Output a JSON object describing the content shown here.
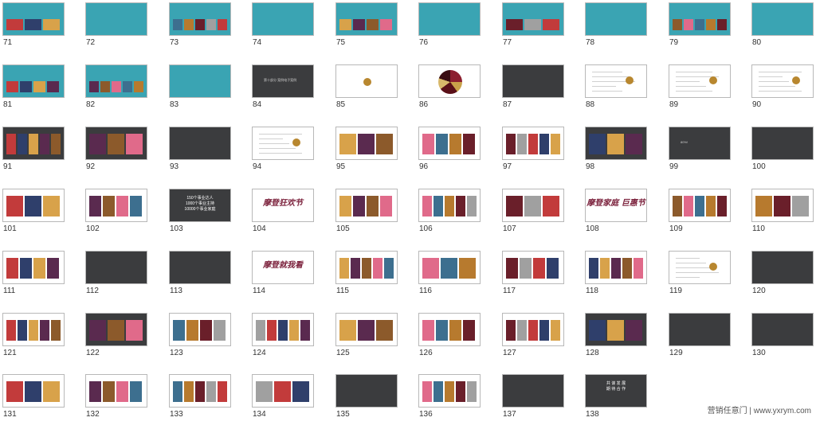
{
  "slides": [
    {
      "n": "71",
      "bg": "teal",
      "kind": "photos"
    },
    {
      "n": "72",
      "bg": "teal",
      "kind": "text"
    },
    {
      "n": "73",
      "bg": "teal",
      "kind": "photos"
    },
    {
      "n": "74",
      "bg": "teal",
      "kind": "text"
    },
    {
      "n": "75",
      "bg": "teal",
      "kind": "photos"
    },
    {
      "n": "76",
      "bg": "teal",
      "kind": "text"
    },
    {
      "n": "77",
      "bg": "teal",
      "kind": "photos"
    },
    {
      "n": "78",
      "bg": "teal",
      "kind": "text"
    },
    {
      "n": "79",
      "bg": "teal",
      "kind": "photos"
    },
    {
      "n": "80",
      "bg": "teal",
      "kind": "text"
    },
    {
      "n": "81",
      "bg": "teal",
      "kind": "photos"
    },
    {
      "n": "82",
      "bg": "teal",
      "kind": "photos"
    },
    {
      "n": "83",
      "bg": "teal",
      "kind": "text"
    },
    {
      "n": "84",
      "bg": "dark",
      "kind": "text",
      "text": "第十部分 案例电子案例"
    },
    {
      "n": "85",
      "bg": "white",
      "kind": "logo"
    },
    {
      "n": "86",
      "bg": "white",
      "kind": "logo-big"
    },
    {
      "n": "87",
      "bg": "dark",
      "kind": "text"
    },
    {
      "n": "88",
      "bg": "white",
      "kind": "doc"
    },
    {
      "n": "89",
      "bg": "white",
      "kind": "doc"
    },
    {
      "n": "90",
      "bg": "white",
      "kind": "doc"
    },
    {
      "n": "91",
      "bg": "dark",
      "kind": "photos"
    },
    {
      "n": "92",
      "bg": "dark",
      "kind": "photos"
    },
    {
      "n": "93",
      "bg": "dark",
      "kind": "text"
    },
    {
      "n": "94",
      "bg": "white",
      "kind": "doc"
    },
    {
      "n": "95",
      "bg": "white",
      "kind": "photos"
    },
    {
      "n": "96",
      "bg": "white",
      "kind": "photos"
    },
    {
      "n": "97",
      "bg": "white",
      "kind": "photos"
    },
    {
      "n": "98",
      "bg": "dark",
      "kind": "photos"
    },
    {
      "n": "99",
      "bg": "dark",
      "kind": "text",
      "text": "80%!"
    },
    {
      "n": "100",
      "bg": "dark",
      "kind": "text"
    },
    {
      "n": "101",
      "bg": "white",
      "kind": "photos"
    },
    {
      "n": "102",
      "bg": "white",
      "kind": "photos"
    },
    {
      "n": "103",
      "bg": "dark",
      "kind": "big",
      "text": "150个事业达人\n1000个事业主持\n10000个事业家庭"
    },
    {
      "n": "104",
      "bg": "white",
      "kind": "script",
      "text": "摩登狂欢节"
    },
    {
      "n": "105",
      "bg": "white",
      "kind": "photos"
    },
    {
      "n": "106",
      "bg": "white",
      "kind": "photos"
    },
    {
      "n": "107",
      "bg": "white",
      "kind": "photos"
    },
    {
      "n": "108",
      "bg": "white",
      "kind": "script",
      "text": "摩登家庭 巨惠节"
    },
    {
      "n": "109",
      "bg": "white",
      "kind": "photos"
    },
    {
      "n": "110",
      "bg": "white",
      "kind": "photos"
    },
    {
      "n": "111",
      "bg": "white",
      "kind": "photos"
    },
    {
      "n": "112",
      "bg": "dark",
      "kind": "text"
    },
    {
      "n": "113",
      "bg": "dark",
      "kind": "text"
    },
    {
      "n": "114",
      "bg": "white",
      "kind": "script",
      "text": "摩登就我看"
    },
    {
      "n": "115",
      "bg": "white",
      "kind": "photos"
    },
    {
      "n": "116",
      "bg": "white",
      "kind": "photos"
    },
    {
      "n": "117",
      "bg": "white",
      "kind": "photos"
    },
    {
      "n": "118",
      "bg": "white",
      "kind": "photos"
    },
    {
      "n": "119",
      "bg": "white",
      "kind": "doc"
    },
    {
      "n": "120",
      "bg": "dark",
      "kind": "text"
    },
    {
      "n": "121",
      "bg": "white",
      "kind": "photos"
    },
    {
      "n": "122",
      "bg": "dark",
      "kind": "photos"
    },
    {
      "n": "123",
      "bg": "white",
      "kind": "photos"
    },
    {
      "n": "124",
      "bg": "white",
      "kind": "photos"
    },
    {
      "n": "125",
      "bg": "white",
      "kind": "photos"
    },
    {
      "n": "126",
      "bg": "white",
      "kind": "photos"
    },
    {
      "n": "127",
      "bg": "white",
      "kind": "photos"
    },
    {
      "n": "128",
      "bg": "dark",
      "kind": "photos"
    },
    {
      "n": "129",
      "bg": "dark",
      "kind": "text"
    },
    {
      "n": "130",
      "bg": "dark",
      "kind": "text"
    },
    {
      "n": "131",
      "bg": "white",
      "kind": "photos"
    },
    {
      "n": "132",
      "bg": "white",
      "kind": "photos"
    },
    {
      "n": "133",
      "bg": "white",
      "kind": "photos"
    },
    {
      "n": "134",
      "bg": "white",
      "kind": "photos"
    },
    {
      "n": "135",
      "bg": "dark",
      "kind": "text"
    },
    {
      "n": "136",
      "bg": "white",
      "kind": "photos"
    },
    {
      "n": "137",
      "bg": "dark",
      "kind": "text"
    },
    {
      "n": "138",
      "bg": "dark",
      "kind": "big",
      "text": "共 谋 发 展\n期 待 合 作"
    }
  ],
  "watermark": "营销任意门 | www.yxrym.com",
  "colors": {
    "teal": "#3aa4b3",
    "dark": "#3b3c3e",
    "white": "#ffffff"
  }
}
